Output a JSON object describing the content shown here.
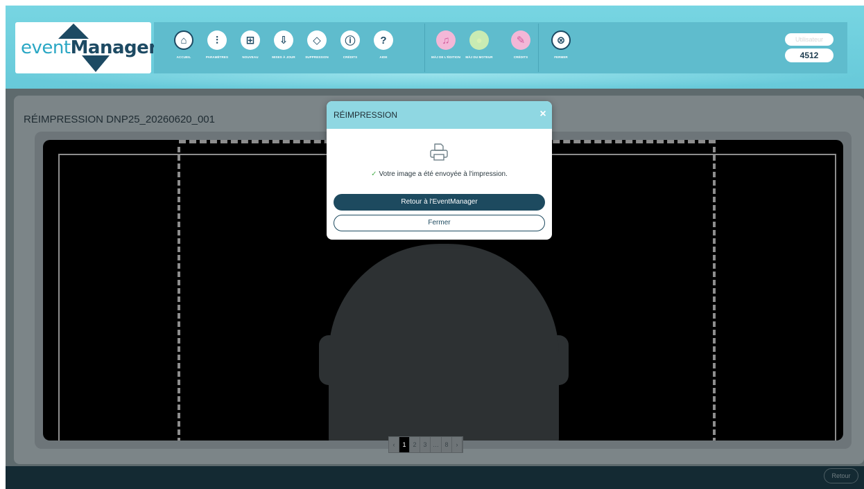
{
  "header": {
    "logo": {
      "text_event": "event",
      "text_manager": "Manager"
    },
    "tools": [
      {
        "label": "ACCUEIL",
        "icon": "home-icon",
        "glyph": "⌂"
      },
      {
        "label": "PARAMÈTRES",
        "icon": "sliders-icon",
        "glyph": "⫶"
      },
      {
        "label": "NOUVEAU",
        "icon": "plus-square-icon",
        "glyph": "⊞"
      },
      {
        "label": "MISES À JOUR",
        "icon": "download-tray-icon",
        "glyph": "⇩"
      },
      {
        "label": "SUPPRESSION",
        "icon": "eraser-icon",
        "glyph": "◇"
      },
      {
        "label": "CRÉDITS",
        "icon": "info-icon",
        "glyph": "ⓘ"
      },
      {
        "label": "AIDE",
        "icon": "help-icon",
        "glyph": "?"
      },
      {
        "label": "MÀJ DE L'ÉDITION",
        "icon": "bell-icon",
        "glyph": "♫"
      },
      {
        "label": "MÀJ DU MOTEUR",
        "icon": "lightbulb-icon",
        "glyph": "●"
      },
      {
        "label": "CRÉDITS",
        "icon": "hand-print-icon",
        "glyph": "✎"
      },
      {
        "label": "FERMER",
        "icon": "close-circle-icon",
        "glyph": "⊗"
      }
    ],
    "user_badge": "Utilisateur",
    "count_badge": "4512"
  },
  "panel": {
    "title": "RÉIMPRESSION DNP25_20260620_001"
  },
  "pager": {
    "items": [
      "‹",
      "1",
      "2",
      "3",
      "…",
      "8",
      "›"
    ],
    "active": "1"
  },
  "footer": {
    "back_label": "Retour"
  },
  "modal": {
    "title": "RÉIMPRESSION",
    "close_glyph": "×",
    "message": "Votre image a été envoyée à l'impression.",
    "primary_label": "Retour à l'EventManager",
    "secondary_label": "Fermer"
  },
  "colors": {
    "header_bg": "#6fcfdd",
    "brand_dark": "#1d4a63",
    "modal_header": "#8fd7e2",
    "primary_button": "#1d4a5f",
    "success_check": "#4caf50"
  }
}
